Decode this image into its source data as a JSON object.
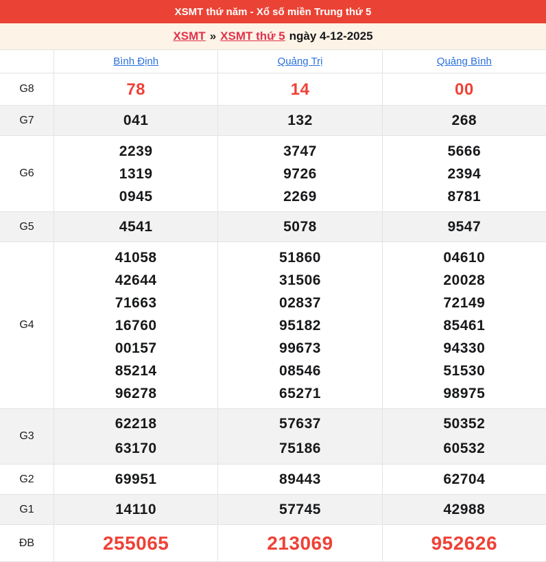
{
  "banner": {
    "title": "XSMT thứ năm - Xổ số miền Trung thứ 5"
  },
  "breadcrumb": {
    "link1": "XSMT",
    "separator": "»",
    "link2": "XSMT thứ 5",
    "date_text": "ngày 4-12-2025"
  },
  "table": {
    "provinces": [
      "Bình Định",
      "Quảng Trị",
      "Quảng Bình"
    ],
    "rows": [
      {
        "label": "G8",
        "style": "red",
        "values": [
          [
            "78"
          ],
          [
            "14"
          ],
          [
            "00"
          ]
        ]
      },
      {
        "label": "G7",
        "style": "normal",
        "values": [
          [
            "041"
          ],
          [
            "132"
          ],
          [
            "268"
          ]
        ]
      },
      {
        "label": "G6",
        "style": "normal",
        "values": [
          [
            "2239",
            "1319",
            "0945"
          ],
          [
            "3747",
            "9726",
            "2269"
          ],
          [
            "5666",
            "2394",
            "8781"
          ]
        ]
      },
      {
        "label": "G5",
        "style": "normal",
        "values": [
          [
            "4541"
          ],
          [
            "5078"
          ],
          [
            "9547"
          ]
        ]
      },
      {
        "label": "G4",
        "style": "normal",
        "values": [
          [
            "41058",
            "42644",
            "71663",
            "16760",
            "00157",
            "85214",
            "96278"
          ],
          [
            "51860",
            "31506",
            "02837",
            "95182",
            "99673",
            "08546",
            "65271"
          ],
          [
            "04610",
            "20028",
            "72149",
            "85461",
            "94330",
            "51530",
            "98975"
          ]
        ]
      },
      {
        "label": "G3",
        "style": "normal",
        "values": [
          [
            "62218",
            "63170"
          ],
          [
            "57637",
            "75186"
          ],
          [
            "50352",
            "60532"
          ]
        ]
      },
      {
        "label": "G2",
        "style": "normal",
        "values": [
          [
            "69951"
          ],
          [
            "89443"
          ],
          [
            "62704"
          ]
        ]
      },
      {
        "label": "G1",
        "style": "normal",
        "values": [
          [
            "14110"
          ],
          [
            "57745"
          ],
          [
            "42988"
          ]
        ]
      },
      {
        "label": "ĐB",
        "style": "red-big",
        "values": [
          [
            "255065"
          ],
          [
            "213069"
          ],
          [
            "952626"
          ]
        ]
      }
    ]
  },
  "colors": {
    "banner_bg": "#EA4335",
    "banner_text": "#FFFFFF",
    "breadcrumb_bg": "#FDF3E6",
    "breadcrumb_link": "#E0314B",
    "province_link": "#2A70DC",
    "stripe_bg": "#F2F2F2",
    "border": "#E3E3E3",
    "number_text": "#17181A",
    "red_number": "#EF4136"
  }
}
